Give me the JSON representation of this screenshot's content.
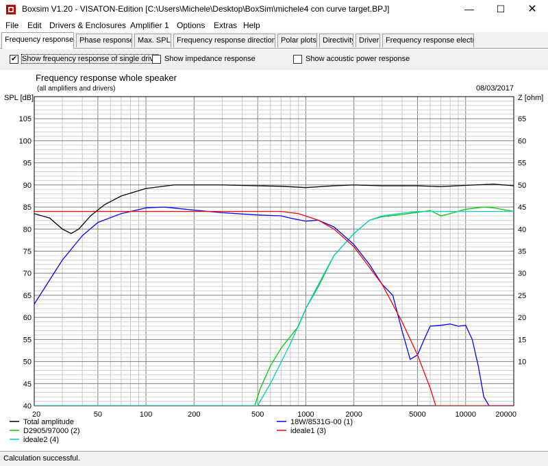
{
  "window": {
    "title": "Boxsim V1.20 - VISATON-Edition [C:\\Users\\Michele\\Desktop\\BoxSim\\michele4 con curve target.BPJ]",
    "minimize": "—",
    "maximize": "☐",
    "close": "✕"
  },
  "menu": [
    "File",
    "Edit",
    "Drivers & Enclosures",
    "Amplifier 1",
    "Options",
    "Extras",
    "Help"
  ],
  "tabs": [
    {
      "label": "Frequency response.",
      "active": true
    },
    {
      "label": "Phase response",
      "active": false
    },
    {
      "label": "Max. SPL",
      "active": false
    },
    {
      "label": "Frequency response directions",
      "active": false
    },
    {
      "label": "Polar plots",
      "active": false
    },
    {
      "label": "Directivity",
      "active": false
    },
    {
      "label": "Driver",
      "active": false
    },
    {
      "label": "Frequency response electr..",
      "active": false
    }
  ],
  "options": [
    {
      "label": "Show frequency response of single drive",
      "checked": true
    },
    {
      "label": "Show impedance response",
      "checked": false
    },
    {
      "label": "Show acoustic power response",
      "checked": false
    }
  ],
  "status": "Calculation successful.",
  "chart_data": {
    "type": "line",
    "title": "Frequency response whole speaker",
    "subtitle": "(all amplifiers and drivers)",
    "date": "08/03/2017",
    "ylabel": "SPL [dB]",
    "y2label": "Z [ohm]",
    "x_scale": "log",
    "xlim": [
      20,
      20000
    ],
    "ylim": [
      40,
      110
    ],
    "y2lim": [
      0,
      70
    ],
    "x_tick_values": [
      20,
      50,
      100,
      200,
      500,
      1000,
      2000,
      5000,
      10000,
      20000
    ],
    "x_tick_labels": [
      "20",
      "50",
      "100",
      "200",
      "500",
      "1000",
      "2000",
      "5000",
      "10000",
      "20000"
    ],
    "y_ticks": [
      40,
      45,
      50,
      55,
      60,
      65,
      70,
      75,
      80,
      85,
      90,
      95,
      100,
      105
    ],
    "y2_ticks": [
      10,
      15,
      20,
      25,
      30,
      35,
      40,
      45,
      50,
      55,
      60,
      65
    ],
    "grid": true,
    "legend_placement": "bottom",
    "series": [
      {
        "name": "Total amplitude",
        "color": "#000000",
        "points": [
          [
            20,
            83.5
          ],
          [
            25,
            82.5
          ],
          [
            30,
            80
          ],
          [
            34,
            79
          ],
          [
            38,
            80
          ],
          [
            45,
            83
          ],
          [
            55,
            85.5
          ],
          [
            70,
            87.5
          ],
          [
            100,
            89.2
          ],
          [
            150,
            90
          ],
          [
            200,
            90
          ],
          [
            300,
            90
          ],
          [
            500,
            89.8
          ],
          [
            700,
            89.7
          ],
          [
            1000,
            89.4
          ],
          [
            1500,
            89.8
          ],
          [
            2000,
            90
          ],
          [
            3000,
            89.8
          ],
          [
            5000,
            89.8
          ],
          [
            7000,
            89.6
          ],
          [
            10000,
            89.9
          ],
          [
            15000,
            90.2
          ],
          [
            20000,
            89.8
          ]
        ]
      },
      {
        "name": "18W/8531G-00 (1)",
        "color": "#0000ff",
        "points": [
          [
            20,
            63
          ],
          [
            25,
            68.5
          ],
          [
            30,
            73
          ],
          [
            40,
            78.5
          ],
          [
            50,
            81.5
          ],
          [
            70,
            83.5
          ],
          [
            100,
            84.8
          ],
          [
            130,
            85
          ],
          [
            200,
            84.3
          ],
          [
            300,
            83.7
          ],
          [
            500,
            83.2
          ],
          [
            700,
            83
          ],
          [
            800,
            82.5
          ],
          [
            1000,
            81.8
          ],
          [
            1200,
            82
          ],
          [
            1500,
            80.5
          ],
          [
            2000,
            76.5
          ],
          [
            2500,
            72
          ],
          [
            3000,
            67.5
          ],
          [
            3500,
            65
          ],
          [
            4000,
            57
          ],
          [
            4500,
            50.5
          ],
          [
            5000,
            51.5
          ],
          [
            5500,
            55
          ],
          [
            6000,
            58
          ],
          [
            7000,
            58.2
          ],
          [
            8000,
            58.5
          ],
          [
            9000,
            58
          ],
          [
            10000,
            58.2
          ],
          [
            11000,
            55
          ],
          [
            12000,
            49
          ],
          [
            13000,
            42
          ],
          [
            14000,
            40
          ],
          [
            20000,
            40
          ]
        ]
      },
      {
        "name": "ideale1 (3)",
        "color": "#ff0000",
        "points": [
          [
            20,
            84
          ],
          [
            100,
            84
          ],
          [
            500,
            84
          ],
          [
            700,
            84
          ],
          [
            900,
            83.5
          ],
          [
            1200,
            82
          ],
          [
            1500,
            80
          ],
          [
            2000,
            76
          ],
          [
            3000,
            67.5
          ],
          [
            4000,
            59
          ],
          [
            5000,
            51.5
          ],
          [
            6000,
            44
          ],
          [
            6500,
            40
          ],
          [
            20000,
            40
          ]
        ]
      },
      {
        "name": "D2905/97000 (2)",
        "color": "#00cc00",
        "points": [
          [
            20,
            40
          ],
          [
            480,
            40
          ],
          [
            520,
            44
          ],
          [
            600,
            49
          ],
          [
            700,
            53
          ],
          [
            900,
            58
          ],
          [
            1000,
            62
          ],
          [
            1200,
            67
          ],
          [
            1500,
            74
          ],
          [
            2000,
            79
          ],
          [
            2500,
            82
          ],
          [
            3000,
            82.8
          ],
          [
            4000,
            83.3
          ],
          [
            5000,
            83.8
          ],
          [
            6000,
            84.2
          ],
          [
            7000,
            83
          ],
          [
            8000,
            83.5
          ],
          [
            10000,
            84.5
          ],
          [
            13000,
            85
          ],
          [
            15000,
            84.8
          ],
          [
            20000,
            84
          ]
        ]
      },
      {
        "name": "ideale2 (4)",
        "color": "#00cccc",
        "points": [
          [
            20,
            40
          ],
          [
            500,
            40
          ],
          [
            600,
            45
          ],
          [
            800,
            54
          ],
          [
            1000,
            62
          ],
          [
            1200,
            67.5
          ],
          [
            1500,
            74
          ],
          [
            2000,
            79
          ],
          [
            2500,
            82
          ],
          [
            3000,
            83
          ],
          [
            4000,
            83.6
          ],
          [
            5000,
            84
          ],
          [
            7000,
            84
          ],
          [
            10000,
            84
          ],
          [
            20000,
            84
          ]
        ]
      }
    ]
  }
}
